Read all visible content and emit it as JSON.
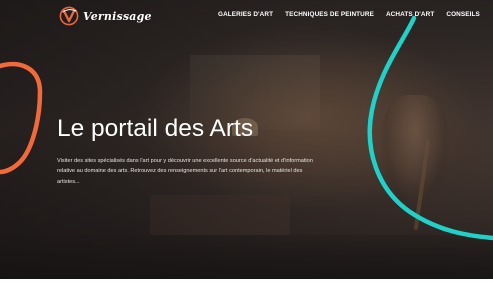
{
  "brand": {
    "name": "Vernissage",
    "logo_icon": "v-brushstroke-logo",
    "accent_color": "#e8663d"
  },
  "nav": {
    "items": [
      {
        "label": "GALERIES D'ART"
      },
      {
        "label": "TECHNIQUES DE PEINTURE"
      },
      {
        "label": "ACHATS D'ART"
      },
      {
        "label": "CONSEILS"
      }
    ]
  },
  "hero": {
    "title": "Le portail des Arts",
    "text": "Visiter des sites spécialisés dans l'art pour y découvrir une excellente source d'actualité et d'information relative au domaine des arts. Retrouvez des renseignements sur l'art contemporain, le matériel des artistes...",
    "curve_colors": {
      "left": "#f26a3a",
      "right": "#1fd1c9"
    }
  }
}
